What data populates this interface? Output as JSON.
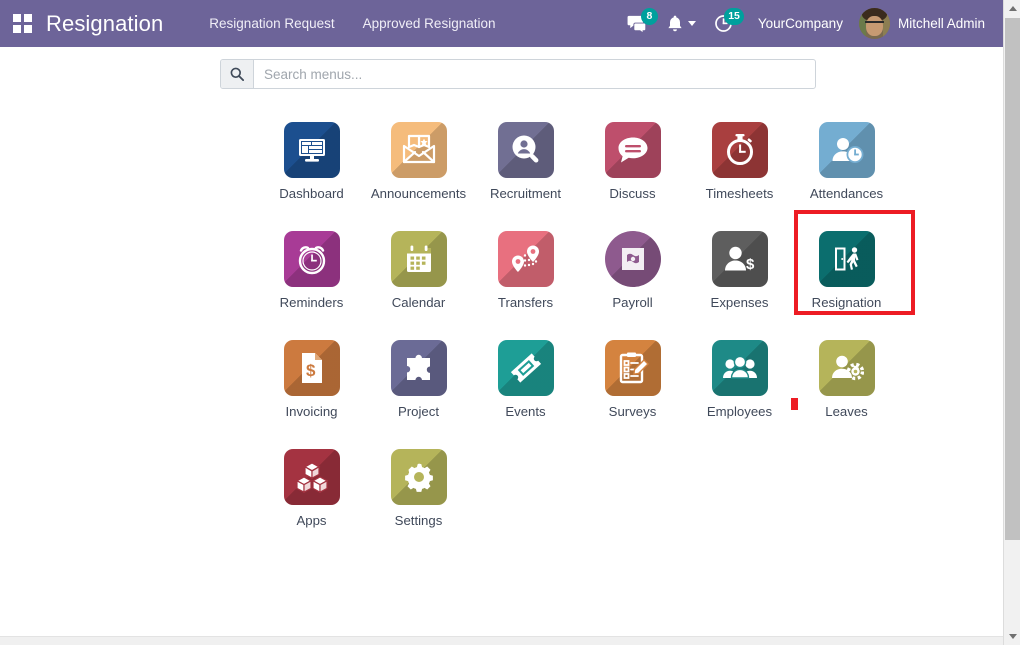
{
  "navbar": {
    "apps_toggle_icon": "grid-icon",
    "brand": "Resignation",
    "menu_items": [
      {
        "label": "Resignation Request"
      },
      {
        "label": "Approved Resignation"
      }
    ],
    "messages": {
      "icon": "messages-icon",
      "badge": "8"
    },
    "activities": {
      "icon": "bell-icon",
      "caret": "chevron-down-icon"
    },
    "clock": {
      "icon": "clock-icon",
      "badge": "15"
    },
    "company": "YourCompany",
    "user": "Mitchell Admin",
    "background_color": "#6d6499",
    "badge_color": "#00a09d"
  },
  "search": {
    "icon": "search-icon",
    "placeholder": "Search menus...",
    "value": ""
  },
  "apps": [
    {
      "label": "Dashboard",
      "icon": "dashboard-icon",
      "color": "#1c4f8f"
    },
    {
      "label": "Announcements",
      "icon": "announcements-icon",
      "color": "#f5bc7c"
    },
    {
      "label": "Recruitment",
      "icon": "recruitment-icon",
      "color": "#716f93"
    },
    {
      "label": "Discuss",
      "icon": "discuss-icon",
      "color": "#be4f6c"
    },
    {
      "label": "Timesheets",
      "icon": "timesheets-icon",
      "color": "#a93f3f"
    },
    {
      "label": "Attendances",
      "icon": "attendances-icon",
      "color": "#74add1"
    },
    {
      "label": "Reminders",
      "icon": "reminders-icon",
      "color": "#a83b96"
    },
    {
      "label": "Calendar",
      "icon": "calendar-icon",
      "color": "#b5b45a"
    },
    {
      "label": "Transfers",
      "icon": "transfers-icon",
      "color": "#e8707f"
    },
    {
      "label": "Payroll",
      "icon": "payroll-icon",
      "color": "#8e5a8e"
    },
    {
      "label": "Expenses",
      "icon": "expenses-icon",
      "color": "#5e5e5e"
    },
    {
      "label": "Resignation",
      "icon": "resignation-icon",
      "color": "#0b6e6e"
    },
    {
      "label": "Invoicing",
      "icon": "invoicing-icon",
      "color": "#cc7a3f"
    },
    {
      "label": "Project",
      "icon": "project-icon",
      "color": "#6b6b96"
    },
    {
      "label": "Events",
      "icon": "events-icon",
      "color": "#1e9e96"
    },
    {
      "label": "Surveys",
      "icon": "surveys-icon",
      "color": "#d4833f"
    },
    {
      "label": "Employees",
      "icon": "employees-icon",
      "color": "#1e8a87"
    },
    {
      "label": "Leaves",
      "icon": "leaves-icon",
      "color": "#b5b45a"
    },
    {
      "label": "Apps",
      "icon": "apps-icon",
      "color": "#a43341"
    },
    {
      "label": "Settings",
      "icon": "settings-icon",
      "color": "#b5b45a"
    }
  ],
  "highlight": {
    "app_label": "Resignation",
    "border_color": "#ed1c24"
  },
  "marker": {
    "color": "#ed1c24"
  }
}
